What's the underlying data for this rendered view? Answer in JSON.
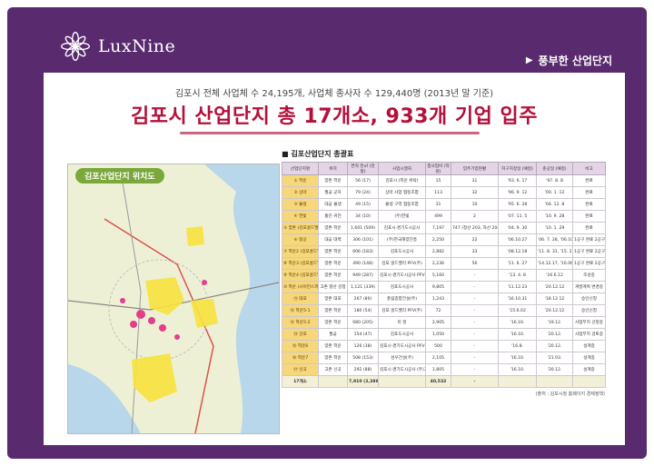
{
  "brand": {
    "name": "LuxNine"
  },
  "tag": {
    "label": "풍부한 산업단지"
  },
  "subhead": "김포시 전체 사업체 수 24,195개, 사업체 종사자 수 129,440명 (2013년 말 기준)",
  "headline": "김포시 산업단지 총 17개소, 933개 기업 입주",
  "map": {
    "label": "김포산업단지 위치도"
  },
  "table": {
    "title": "■ 김포산업단지 총괄표",
    "headers": [
      "산업단지명",
      "위치",
      "면적 천㎡ (천평)",
      "사업시행자",
      "총사업비 (억원)",
      "입주기업현황",
      "지구지정일 (예정)",
      "준공일 (예정)",
      "비고"
    ],
    "rows": [
      [
        "① 학운",
        "양촌 학운",
        "56 (17)",
        "김포시 (학운 위탁)",
        "15",
        "31",
        "'93. 6. 17",
        "'97. 8. 8",
        "완료"
      ],
      [
        "② 상마",
        "월곶 군하",
        "79 (24)",
        "상마 사업 협동조합",
        "113",
        "32",
        "'96. 9. 12",
        "'00. 1. 12",
        "완료"
      ],
      [
        "③ 율생",
        "대곶 율생",
        "49 (15)",
        "율생 구역 협동조합",
        "31",
        "10",
        "'95. 6. 28",
        "'04. 12. 8",
        "완료"
      ],
      [
        "④ 한빛",
        "통진 귀전",
        "34 (10)",
        "(주)한빛",
        "499",
        "2",
        "'07. 11. 5",
        "'10. 9. 28",
        "완료"
      ],
      [
        "⑤ 양촌 (김포골드밸리)",
        "양촌 학운",
        "1,601 (509)",
        "김포시·경기도시공사",
        "7,197",
        "747 (정산 203, 자산 204)",
        "'04. 9. 30",
        "'10. 1. 29",
        "완료"
      ],
      [
        "⑥ 항공",
        "대곶 대벽",
        "306 (101)",
        "(주)한국해양진흥",
        "2,250",
        "22",
        "'06.10.27",
        "'06. 7. 28, '06.10.27",
        "1공구 완료 2공구 조성"
      ],
      [
        "⑦ 학운2 (김포골드밸리)",
        "양촌 학운",
        "606 (183)",
        "김포도시공사",
        "2,882",
        "33",
        "'08.12.18",
        "'11. 8. 31, '15. 2. 5",
        "1공구 완료 2공구 조성"
      ],
      [
        "⑧ 학운3 (김포골드밸리)",
        "양촌 학운",
        "490 (148)",
        "김포 골드밸리 PFV(주)",
        "2,236",
        "56",
        "'11. 6. 27",
        "'14.12.17, '16.06.29",
        "1공구 완료 2공구 조성"
      ],
      [
        "⑨ 학운4 (김포골드밸리)",
        "양촌 학운",
        "949 (287)",
        "김포시·경기도시공사 PFV(주)",
        "5,160",
        "-",
        "'13. 4. 8",
        "'16.6.12",
        "조성중"
      ],
      [
        "⑩ 학운 (사이언스파크)",
        "고촌 향산 감정",
        "1,121 (339)",
        "김포도시공사",
        "9,805",
        "-",
        "'11.12.23",
        "'20.12.12",
        "개발계획 변경중"
      ],
      [
        "⑪ 대포",
        "양촌 대포",
        "267 (80)",
        "풍림종합건설(주)",
        "1,243",
        "-",
        "'16.10.31",
        "'18.12.12",
        "승인신청"
      ],
      [
        "⑫ 학운5-1",
        "양촌 학운",
        "180 (54)",
        "김포 골드밸리 PFV(주)",
        "72",
        "-",
        "'15.6.02",
        "'20.12.12",
        "승인신청"
      ],
      [
        "⑬ 학운5-2",
        "양촌 학운",
        "680 (205)",
        "미 정",
        "2,905",
        "-",
        "'16.10.",
        "'19.12.",
        "사업부지 선정중"
      ],
      [
        "⑭ 강포",
        "월곶",
        "154 (47)",
        "김포도시공사",
        "1,050",
        "-",
        "'16.10.",
        "'20.12.",
        "사업부지 검토중"
      ],
      [
        "⑮ 학운6",
        "양촌 학운",
        "126 (38)",
        "김포시·경기도시공사 PFV(주)",
        "500",
        "-",
        "'16.8.",
        "'20.12.",
        "설계중"
      ],
      [
        "⑯ 학운7",
        "양촌 학운",
        "508 (153)",
        "성우건설(주)",
        "2,105",
        "-",
        "'16.10.",
        "'21.03.",
        "설계중"
      ],
      [
        "⑰ 신곡",
        "고촌 신곡",
        "292 (88)",
        "김포시·경기도시공사 (주)고신",
        "1,805",
        "-",
        "'16.10.",
        "'20.12.",
        "설계중"
      ]
    ],
    "total": [
      "17개소",
      "",
      "7,910 (2,389)",
      "",
      "40,532",
      "-",
      "",
      "",
      ""
    ],
    "source": "(출처 : 김포시청 홈페이지 경제정책)"
  },
  "colors": {
    "frame": "#5a2a6e",
    "headline": "#b5103a",
    "header_bg": "#e3d5e6",
    "name_bg": "#f6d77a"
  }
}
